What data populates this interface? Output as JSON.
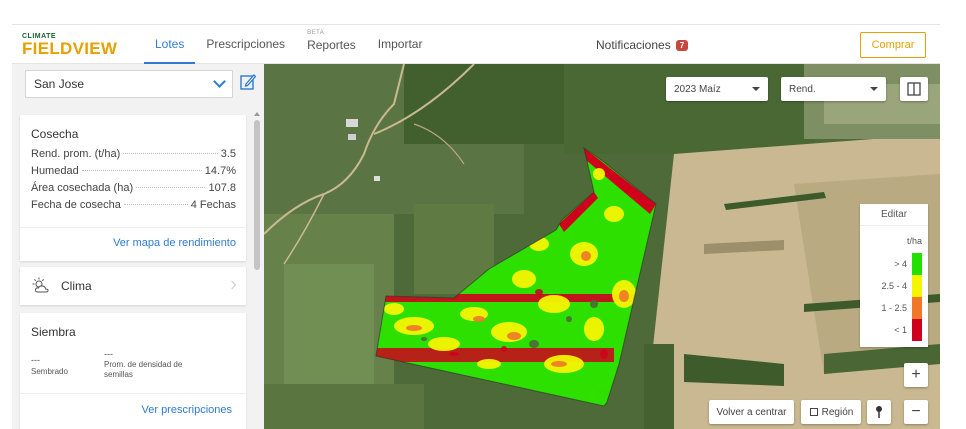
{
  "brand": {
    "small": "CLIMATE",
    "name": "FIELDVIEW"
  },
  "nav": {
    "tabs": [
      {
        "label": "Lotes"
      },
      {
        "label": "Prescripciones"
      },
      {
        "label": "Reportes",
        "tag": "BETA"
      },
      {
        "label": "Importar"
      }
    ],
    "notifications": {
      "label": "Notificaciones",
      "count": "7"
    },
    "buy": "Comprar"
  },
  "sidebar": {
    "farm": "San Jose",
    "harvest": {
      "title": "Cosecha",
      "rows": [
        {
          "label": "Rend. prom. (t/ha)",
          "value": "3.5"
        },
        {
          "label": "Humedad",
          "value": "14.7%"
        },
        {
          "label": "Área cosechada (ha)",
          "value": "107.8"
        },
        {
          "label": "Fecha de cosecha",
          "value": "4 Fechas"
        }
      ],
      "link": "Ver mapa de rendimiento"
    },
    "weather": {
      "label": "Clima"
    },
    "sowing": {
      "title": "Siembra",
      "sown_value": "---",
      "sown_label": "Sembrado",
      "density_value": "---",
      "density_label": "Prom. de densidad de semillas",
      "link": "Ver prescripciones"
    }
  },
  "map": {
    "season_select": "2023 Maíz",
    "layer_select": "Rend.",
    "legend": {
      "edit": "Editar",
      "unit": "t/ha",
      "items": [
        {
          "label": "> 4",
          "color": "#22e000"
        },
        {
          "label": "2.5 - 4",
          "color": "#f5f500"
        },
        {
          "label": "1 - 2.5",
          "color": "#f07828"
        },
        {
          "label": "< 1",
          "color": "#d0001c"
        }
      ]
    },
    "recenter": "Volver a centrar",
    "region": "Región",
    "zoom_in": "+",
    "zoom_out": "−"
  },
  "colors": {
    "accent": "#2f7bd1",
    "brand": "#e8a000",
    "badge": "#c9463d"
  }
}
